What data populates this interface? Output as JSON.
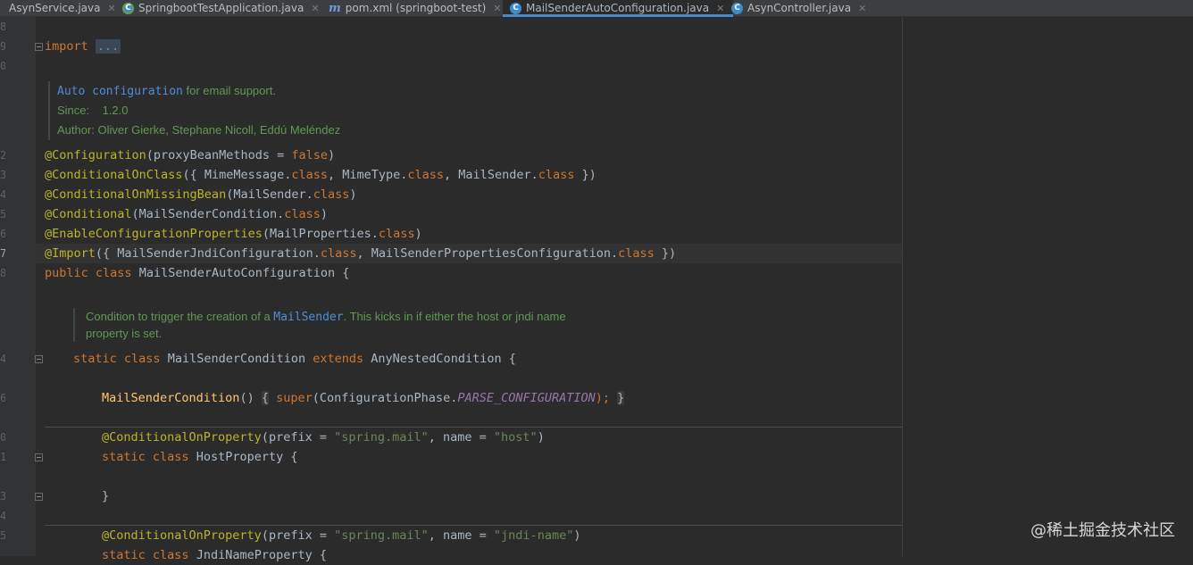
{
  "tabs": [
    {
      "label": "AsynService.java",
      "icon": "class-icon"
    },
    {
      "label": "SpringbootTestApplication.java",
      "icon": "spring-boot-class-icon"
    },
    {
      "label": "pom.xml (springboot-test)",
      "icon": "maven-icon"
    },
    {
      "label": "MailSenderAutoConfiguration.java",
      "icon": "class-icon",
      "active": true
    },
    {
      "label": "AsynController.java",
      "icon": "class-icon"
    }
  ],
  "gutter": {
    "line_numbers": [
      "8",
      "9",
      "0",
      "2",
      "3",
      "4",
      "5",
      "6",
      "7",
      "8",
      "4",
      "6",
      "0",
      "1",
      "3",
      "4",
      "5"
    ]
  },
  "code": {
    "import_kw": "import",
    "import_fold": "...",
    "doc1": {
      "l1a": "Auto configuration",
      "l1b": " for email support.",
      "l2a": "Since:",
      "l2b": "1.2.0",
      "l3": "Author: Oliver Gierke, Stephane Nicoll, Eddú Meléndez"
    },
    "l_config_ann": "@Configuration",
    "l_config_rest_a": "(proxyBeanMethods = ",
    "l_config_false": "false",
    "l_config_rest_b": ")",
    "l_coc_ann": "@ConditionalOnClass",
    "l_coc_a": "({ MimeMessage.",
    "l_coc_k1": "class",
    "l_coc_b": ", MimeType.",
    "l_coc_k2": "class",
    "l_coc_c": ", MailSender.",
    "l_coc_k3": "class",
    "l_coc_d": " })",
    "l_comb_ann": "@ConditionalOnMissingBean",
    "l_comb_a": "(MailSender.",
    "l_comb_k": "class",
    "l_comb_b": ")",
    "l_cond_ann": "@Conditional",
    "l_cond_a": "(MailSenderCondition.",
    "l_cond_k": "class",
    "l_cond_b": ")",
    "l_ecp_ann": "@EnableConfigurationProperties",
    "l_ecp_a": "(MailProperties.",
    "l_ecp_k": "class",
    "l_ecp_b": ")",
    "l_imp_ann": "@Import",
    "l_imp_a": "({ MailSenderJndiConfiguration.",
    "l_imp_k1": "class",
    "l_imp_b": ", MailSenderPropertiesConfiguration.",
    "l_imp_k2": "class",
    "l_imp_c": " })",
    "l_pub_k1": "public",
    "l_pub_k2": "class",
    "l_pub_rest": " MailSenderAutoConfiguration {",
    "doc2": {
      "l1a": "Condition to trigger the creation of a ",
      "l1code": "MailSender",
      "l1b": ". This kicks in if either the host or jndi name",
      "l2": "property is set."
    },
    "l_msc_k1": "static",
    "l_msc_k2": "class",
    "l_msc_a": " MailSenderCondition ",
    "l_msc_k3": "extends",
    "l_msc_b": " AnyNestedCondition {",
    "l_ctor_fn": "MailSenderCondition",
    "l_ctor_a": "()",
    "l_ctor_b": "{",
    "l_ctor_super": "super",
    "l_ctor_c": "(ConfigurationPhase.",
    "l_ctor_const": "PARSE_CONFIGURATION",
    "l_ctor_d": ");",
    "l_ctor_e": "}",
    "l_cop1_ann": "@ConditionalOnProperty",
    "l_cop1_a": "(prefix = ",
    "l_cop1_s1": "\"spring.mail\"",
    "l_cop1_b": ", name = ",
    "l_cop1_s2": "\"host\"",
    "l_cop1_c": ")",
    "l_hp_k1": "static",
    "l_hp_k2": "class",
    "l_hp_rest": " HostProperty {",
    "l_close": "}",
    "l_cop2_ann": "@ConditionalOnProperty",
    "l_cop2_a": "(prefix = ",
    "l_cop2_s1": "\"spring.mail\"",
    "l_cop2_b": ", name = ",
    "l_cop2_s2": "\"jndi-name\"",
    "l_cop2_c": ")",
    "l_jp_k1": "static",
    "l_jp_k2": "class",
    "l_jp_rest": " JndiNameProperty {"
  },
  "watermark": "@稀土掘金技术社区"
}
